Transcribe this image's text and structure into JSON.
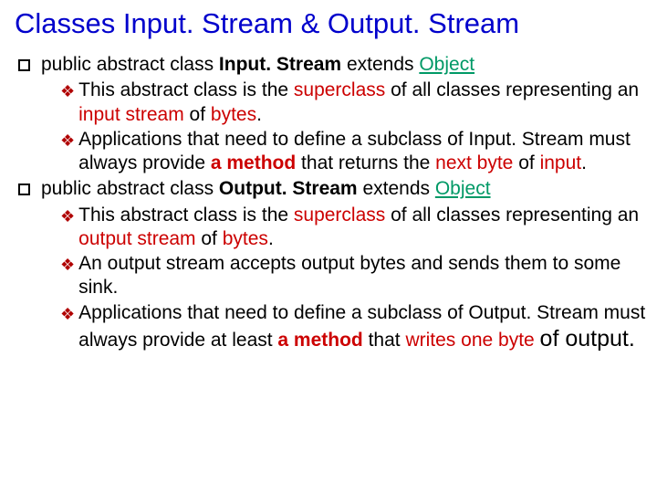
{
  "title": "Classes  Input. Stream  &  Output. Stream",
  "s1": {
    "pre": "public abstract class ",
    "cls": "Input. Stream",
    "ext": "  extends ",
    "obj": "Object",
    "a": {
      "t1": "This abstract class is the ",
      "t2": "superclass",
      "t3": " of all classes representing an ",
      "t4": "input stream",
      "t5": " of ",
      "t6": "bytes",
      "t7": "."
    },
    "b": {
      "t1": "Applications that need to define a subclass of Input. Stream must always provide ",
      "t2": "a method",
      "t3": " that returns the ",
      "t4": "next byte",
      "t5": " of ",
      "t6": "input",
      "t7": "."
    }
  },
  "s2": {
    "pre": "public abstract class ",
    "cls": "Output. Stream",
    "ext": " extends ",
    "obj": "Object",
    "a": {
      "t1": "This abstract class is the ",
      "t2": "superclass",
      "t3": " of all classes representing an ",
      "t4": "output stream",
      "t5": " of ",
      "t6": "bytes",
      "t7": "."
    },
    "b": {
      "t1": "An output stream accepts output bytes and sends them to some sink."
    },
    "c": {
      "t1": "Applications that need to define a subclass of Output. Stream must always provide at least ",
      "t2": "a method",
      "t3": " that ",
      "t4": "writes one byte ",
      "t5": "of",
      "t6": " output.",
      "t7": ""
    }
  }
}
